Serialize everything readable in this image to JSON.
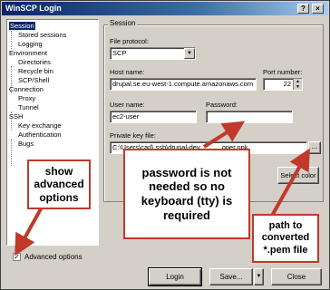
{
  "window": {
    "title": "WinSCP Login",
    "help_glyph": "?",
    "close_glyph": "×"
  },
  "tree": {
    "items": [
      {
        "label": "Session",
        "selected": true
      },
      {
        "label": "Stored sessions"
      },
      {
        "label": "Logging"
      },
      {
        "label": "Environment"
      },
      {
        "label": "Directories"
      },
      {
        "label": "Recycle bin"
      },
      {
        "label": "SCP/Shell"
      },
      {
        "label": "Connection"
      },
      {
        "label": "Proxy"
      },
      {
        "label": "Tunnel"
      },
      {
        "label": "SSH"
      },
      {
        "label": "Key exchange"
      },
      {
        "label": "Authentication"
      },
      {
        "label": "Bugs"
      }
    ]
  },
  "session": {
    "group_title": "Session",
    "file_protocol_label": "File protocol:",
    "file_protocol_value": "SCP",
    "host_name_label": "Host name:",
    "host_name_value": "drupal.se.eu-west-1.compute.amazonaws.com",
    "port_label": "Port number:",
    "port_value": "22",
    "user_name_label": "User name:",
    "user_name_value": "ec2-user",
    "password_label": "Password:",
    "password_value": "",
    "private_key_label": "Private key file:",
    "private_key_value": "C:\\Users\\carl\\.ssh\\drupal-dev",
    "private_key_tail": "oper.ppk",
    "browse_label": "...",
    "select_color_label": "Select color"
  },
  "advanced": {
    "label": "Advanced options",
    "checked": "✓"
  },
  "buttons": {
    "login": "Login",
    "save": "Save...",
    "save_arrow": "▼",
    "close": "Close"
  },
  "callouts": {
    "advanced": "show advanced options",
    "password": "password is not needed so no keyboard (tty) is required",
    "path": "path to converted *.pem file"
  },
  "colors": {
    "annotation": "#c0392b",
    "selection": "#0a246a"
  }
}
